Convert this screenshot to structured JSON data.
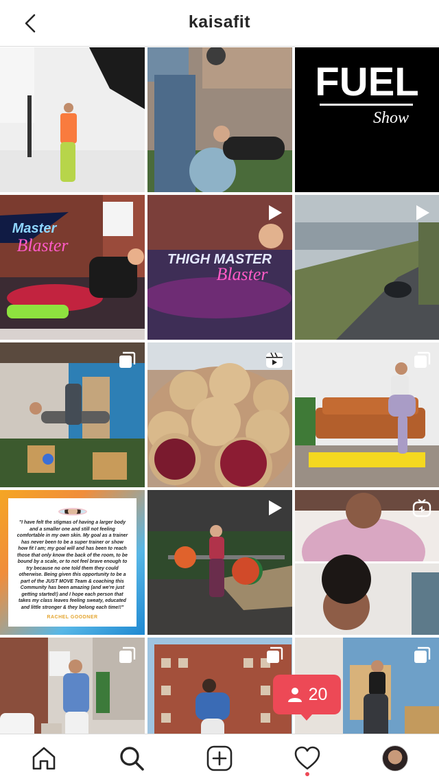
{
  "header": {
    "title": "kaisafit"
  },
  "posts": [
    {
      "type": "photo",
      "description": "woman in orange top and green pants in a photo studio"
    },
    {
      "type": "photo",
      "description": "trainer assisting woman on a stability ball in a gym"
    },
    {
      "type": "photo",
      "overlay_lines": [
        "FUEL",
        "Show"
      ]
    },
    {
      "type": "photo",
      "overlay_lines": [
        "Master",
        "Blaster"
      ]
    },
    {
      "type": "video",
      "overlay_lines": [
        "THIGH MASTER",
        "Blaster"
      ]
    },
    {
      "type": "video",
      "description": "car driving along a coastal road"
    },
    {
      "type": "carousel",
      "description": "woman exercising on plyo boxes in a gym"
    },
    {
      "type": "reel",
      "description": "scones topped with jam"
    },
    {
      "type": "carousel",
      "description": "woman balancing on a yoga mat in a living room"
    },
    {
      "type": "photo",
      "quote": "\"I have felt the stigmas of having a larger body and a smaller one and still not feeling comfortable in my own skin. My goal as a trainer has never been to be a super trainer or show how fit I am; my goal will and has been to reach those that only know the back of the room, to be bound by a scale, or to not feel brave enough to try because no one told them they could otherwise. Being given this opportunity to be a part of the JUST MOVE Team & coaching this Community has been amazing (and we're just getting started!) and I hope each person that takes my class leaves feeling sweaty, educated and little stronger & they belong each time!!\"",
      "author": "RACHEL GOODNER"
    },
    {
      "type": "video",
      "description": "woman deadlifting a barbell"
    },
    {
      "type": "igtv",
      "description": "split screen of two women on a video call"
    },
    {
      "type": "carousel",
      "description": "woman in denim jacket in a loft"
    },
    {
      "type": "carousel",
      "description": "woman dancing in front of a brick building"
    },
    {
      "type": "carousel",
      "description": "woman in black workout clothes in a gym"
    }
  ],
  "badge": {
    "count": "20"
  },
  "tabbar": {
    "items": [
      "home",
      "search",
      "new-post",
      "activity",
      "profile"
    ]
  },
  "colors": {
    "accent": "#ed4956",
    "text": "#262626",
    "border": "#dbdbdb"
  }
}
